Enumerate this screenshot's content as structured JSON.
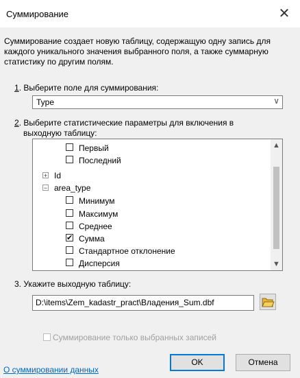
{
  "window": {
    "title": "Суммирование"
  },
  "description": "Суммирование создает новую таблицу, содержащую одну запись для каждого уникального значения выбранного поля, а также суммарную статистику по другим полям.",
  "step1": {
    "number": "1",
    "text": ". Выберите поле для суммирования:"
  },
  "field_select": {
    "value": "Type"
  },
  "step2": {
    "number": "2",
    "line1": ". Выберите статистические параметры для включения в",
    "line2": "выходную таблицу:"
  },
  "tree": {
    "items": [
      {
        "label": "Первый",
        "checked": false
      },
      {
        "label": "Последний",
        "checked": false
      },
      {
        "label": "Id",
        "expander": "+"
      },
      {
        "label": "area_type",
        "expander": "−"
      },
      {
        "label": "Минимум",
        "checked": false
      },
      {
        "label": "Максимум",
        "checked": false
      },
      {
        "label": "Среднее",
        "checked": false
      },
      {
        "label": "Сумма",
        "checked": true
      },
      {
        "label": "Стандартное отклонение",
        "checked": false
      },
      {
        "label": "Дисперсия",
        "checked": false
      }
    ]
  },
  "step3": {
    "text": "3. Укажите выходную таблицу:"
  },
  "output_table": {
    "value": "D:\\items\\Zem_kadastr_pract\\Владения_Sum.dbf"
  },
  "selected_only": {
    "label": "Суммирование только выбранных записей",
    "checked": false,
    "enabled": false
  },
  "help_link": "О суммировании данных",
  "buttons": {
    "ok": "OK",
    "cancel": "Отмена"
  }
}
